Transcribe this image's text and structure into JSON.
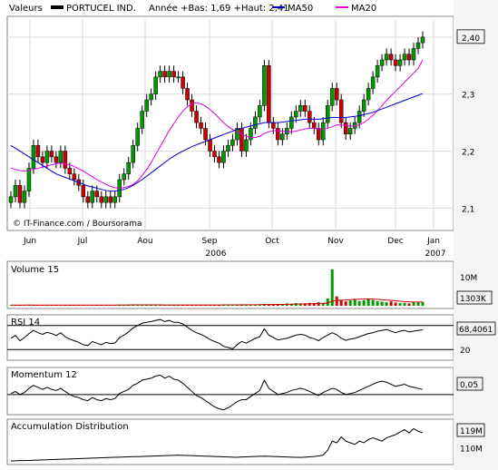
{
  "header": {
    "instrument_prefix": "Valeurs",
    "instrument": "PORTUCEL IND.",
    "range_text": "Année +Bas: 1,69 +Haut: 2,41",
    "ma50_label": "MA50",
    "ma20_label": "MA20"
  },
  "copyright": "© IT-Finance.com / Boursorama",
  "colors": {
    "up_candle": "#009900",
    "down_candle": "#cc0000",
    "ma50": "#0000cc",
    "ma20": "#dd00dd",
    "panel_bg": "#ffffff",
    "frame": "#888888"
  },
  "chart_data": [
    {
      "type": "candlestick",
      "panel": "price",
      "y_ticks": [
        "2,1",
        "2,2",
        "2,3",
        "2,40"
      ],
      "last_value": "2,40",
      "ylim": [
        2.08,
        2.43
      ],
      "x_ticks": [
        "Jun",
        "Jul",
        "Aou",
        "Sep",
        "Oct",
        "Nov",
        "Dec",
        "Jan"
      ],
      "x_subticks": [
        "2006",
        "2007"
      ],
      "closes": [
        2.12,
        2.14,
        2.11,
        2.13,
        2.17,
        2.21,
        2.19,
        2.18,
        2.2,
        2.19,
        2.18,
        2.2,
        2.17,
        2.16,
        2.15,
        2.14,
        2.12,
        2.11,
        2.13,
        2.12,
        2.11,
        2.12,
        2.11,
        2.12,
        2.15,
        2.16,
        2.18,
        2.21,
        2.24,
        2.27,
        2.29,
        2.3,
        2.33,
        2.34,
        2.33,
        2.34,
        2.33,
        2.33,
        2.31,
        2.29,
        2.27,
        2.25,
        2.24,
        2.22,
        2.2,
        2.19,
        2.18,
        2.2,
        2.21,
        2.22,
        2.24,
        2.2,
        2.22,
        2.24,
        2.26,
        2.28,
        2.35,
        2.25,
        2.24,
        2.22,
        2.23,
        2.24,
        2.26,
        2.27,
        2.28,
        2.27,
        2.25,
        2.24,
        2.22,
        2.25,
        2.28,
        2.31,
        2.29,
        2.25,
        2.23,
        2.24,
        2.25,
        2.27,
        2.29,
        2.31,
        2.33,
        2.35,
        2.36,
        2.37,
        2.36,
        2.35,
        2.36,
        2.37,
        2.36,
        2.38,
        2.39,
        2.4
      ],
      "ma50": [
        2.21,
        2.205,
        2.2,
        2.195,
        2.19,
        2.185,
        2.18,
        2.175,
        2.17,
        2.165,
        2.16,
        2.157,
        2.154,
        2.151,
        2.148,
        2.145,
        2.142,
        2.139,
        2.137,
        2.135,
        2.133,
        2.131,
        2.13,
        2.13,
        2.131,
        2.133,
        2.136,
        2.14,
        2.145,
        2.15,
        2.156,
        2.162,
        2.168,
        2.174,
        2.18,
        2.186,
        2.191,
        2.196,
        2.2,
        2.204,
        2.208,
        2.211,
        2.214,
        2.217,
        2.22,
        2.223,
        2.226,
        2.229,
        2.232,
        2.235,
        2.238,
        2.24,
        2.242,
        2.244,
        2.246,
        2.248,
        2.25,
        2.25,
        2.25,
        2.25,
        2.251,
        2.252,
        2.253,
        2.254,
        2.255,
        2.256,
        2.256,
        2.256,
        2.256,
        2.257,
        2.258,
        2.259,
        2.259,
        2.259,
        2.259,
        2.26,
        2.261,
        2.262,
        2.264,
        2.266,
        2.268,
        2.271,
        2.274,
        2.277,
        2.28,
        2.283,
        2.286,
        2.289,
        2.292,
        2.295,
        2.298,
        2.301
      ],
      "ma20": [
        2.17,
        2.168,
        2.166,
        2.165,
        2.166,
        2.168,
        2.17,
        2.172,
        2.174,
        2.176,
        2.178,
        2.179,
        2.178,
        2.176,
        2.173,
        2.169,
        2.165,
        2.16,
        2.155,
        2.15,
        2.146,
        2.142,
        2.138,
        2.136,
        2.135,
        2.136,
        2.138,
        2.142,
        2.148,
        2.157,
        2.168,
        2.18,
        2.194,
        2.208,
        2.222,
        2.236,
        2.248,
        2.26,
        2.27,
        2.278,
        2.283,
        2.285,
        2.283,
        2.279,
        2.273,
        2.266,
        2.258,
        2.25,
        2.243,
        2.238,
        2.234,
        2.23,
        2.226,
        2.224,
        2.224,
        2.226,
        2.231,
        2.234,
        2.236,
        2.236,
        2.235,
        2.234,
        2.234,
        2.235,
        2.237,
        2.239,
        2.24,
        2.24,
        2.238,
        2.238,
        2.24,
        2.243,
        2.246,
        2.246,
        2.245,
        2.244,
        2.244,
        2.246,
        2.25,
        2.256,
        2.263,
        2.271,
        2.28,
        2.289,
        2.297,
        2.305,
        2.313,
        2.321,
        2.329,
        2.337,
        2.345,
        2.36
      ]
    },
    {
      "type": "bar",
      "panel": "volume",
      "label": "Volume 15",
      "y_ticks": [
        "10M"
      ],
      "last_value": "1303K",
      "ylim": [
        0,
        14
      ],
      "values_millions": [
        0.2,
        0.3,
        0.2,
        0.1,
        0.4,
        0.3,
        0.2,
        0.2,
        0.3,
        0.2,
        0.2,
        0.1,
        0.3,
        0.2,
        0.2,
        0.3,
        0.2,
        0.1,
        0.2,
        0.3,
        0.2,
        0.2,
        0.1,
        0.2,
        0.3,
        0.3,
        0.4,
        0.5,
        0.4,
        0.3,
        0.3,
        0.4,
        0.3,
        0.2,
        0.2,
        0.3,
        0.2,
        0.3,
        0.2,
        0.3,
        0.3,
        0.2,
        0.3,
        0.3,
        0.2,
        0.3,
        0.3,
        0.4,
        0.3,
        0.2,
        0.3,
        0.5,
        0.4,
        0.3,
        0.4,
        0.4,
        0.6,
        0.5,
        0.4,
        0.5,
        0.6,
        0.8,
        0.7,
        0.9,
        0.6,
        0.8,
        1.0,
        0.9,
        1.2,
        0.8,
        2.5,
        12.5,
        3.2,
        2.0,
        1.5,
        1.8,
        2.2,
        1.6,
        1.9,
        2.4,
        2.0,
        1.6,
        1.4,
        1.2,
        1.5,
        1.1,
        0.9,
        1.0,
        0.8,
        1.2,
        1.1,
        1.3
      ],
      "average_millions": [
        0.25,
        0.25,
        0.25,
        0.25,
        0.25,
        0.25,
        0.25,
        0.25,
        0.25,
        0.25,
        0.25,
        0.25,
        0.25,
        0.25,
        0.25,
        0.25,
        0.25,
        0.25,
        0.25,
        0.25,
        0.25,
        0.25,
        0.25,
        0.25,
        0.26,
        0.27,
        0.28,
        0.3,
        0.3,
        0.3,
        0.3,
        0.3,
        0.3,
        0.3,
        0.29,
        0.28,
        0.28,
        0.28,
        0.28,
        0.28,
        0.28,
        0.28,
        0.28,
        0.28,
        0.28,
        0.28,
        0.29,
        0.3,
        0.3,
        0.3,
        0.3,
        0.32,
        0.34,
        0.35,
        0.36,
        0.37,
        0.4,
        0.42,
        0.43,
        0.45,
        0.48,
        0.52,
        0.55,
        0.6,
        0.62,
        0.65,
        0.7,
        0.74,
        0.8,
        0.82,
        0.95,
        1.6,
        1.8,
        1.9,
        2.0,
        2.1,
        2.2,
        2.25,
        2.3,
        2.35,
        2.3,
        2.2,
        2.1,
        1.95,
        1.85,
        1.7,
        1.55,
        1.45,
        1.35,
        1.3,
        1.3,
        1.3
      ]
    },
    {
      "type": "line",
      "panel": "rsi",
      "label": "RSI 14",
      "y_ticks": [
        "20"
      ],
      "last_value": "68,4061",
      "ylim": [
        0,
        100
      ],
      "levels": [
        80,
        20
      ],
      "values": [
        48,
        55,
        42,
        50,
        60,
        68,
        62,
        58,
        63,
        60,
        55,
        62,
        52,
        46,
        42,
        38,
        32,
        30,
        40,
        36,
        32,
        38,
        35,
        36,
        50,
        56,
        64,
        74,
        80,
        86,
        88,
        90,
        93,
        95,
        90,
        93,
        88,
        88,
        84,
        76,
        68,
        62,
        58,
        52,
        45,
        40,
        36,
        28,
        25,
        22,
        32,
        40,
        36,
        42,
        48,
        52,
        72,
        56,
        50,
        44,
        46,
        48,
        52,
        56,
        58,
        56,
        50,
        47,
        42,
        50,
        56,
        62,
        57,
        48,
        43,
        46,
        48,
        52,
        56,
        60,
        62,
        66,
        68,
        70,
        66,
        62,
        66,
        68,
        64,
        66,
        68,
        69
      ]
    },
    {
      "type": "line",
      "panel": "momentum",
      "label": "Momentum 12",
      "y_ticks": [],
      "last_value": "0,05",
      "ylim": [
        -0.17,
        0.22
      ],
      "zero_line": 0,
      "values": [
        0.01,
        0.03,
        0.0,
        0.02,
        0.06,
        0.09,
        0.07,
        0.05,
        0.07,
        0.05,
        0.04,
        0.06,
        0.03,
        0.0,
        -0.02,
        -0.03,
        -0.05,
        -0.06,
        -0.03,
        -0.05,
        -0.06,
        -0.04,
        -0.05,
        -0.04,
        0.01,
        0.03,
        0.05,
        0.09,
        0.11,
        0.14,
        0.15,
        0.16,
        0.18,
        0.19,
        0.16,
        0.18,
        0.15,
        0.14,
        0.11,
        0.07,
        0.03,
        -0.01,
        -0.03,
        -0.06,
        -0.09,
        -0.12,
        -0.14,
        -0.15,
        -0.13,
        -0.1,
        -0.07,
        -0.05,
        -0.05,
        -0.02,
        0.01,
        0.04,
        0.14,
        0.06,
        0.03,
        0.0,
        0.01,
        0.02,
        0.04,
        0.05,
        0.06,
        0.05,
        0.03,
        0.01,
        -0.01,
        0.02,
        0.04,
        0.06,
        0.05,
        0.02,
        0.0,
        0.01,
        0.02,
        0.04,
        0.06,
        0.08,
        0.1,
        0.12,
        0.13,
        0.12,
        0.1,
        0.08,
        0.09,
        0.1,
        0.08,
        0.07,
        0.06,
        0.05
      ]
    },
    {
      "type": "line",
      "panel": "accumulation",
      "label": "Accumulation Distribution",
      "y_ticks": [
        "110M"
      ],
      "last_value": "119M",
      "ylim": [
        102,
        124
      ],
      "values_millions": [
        102.0,
        102.1,
        102.2,
        102.2,
        102.3,
        102.4,
        102.5,
        102.6,
        102.7,
        102.8,
        102.9,
        103.0,
        103.1,
        103.2,
        103.3,
        103.4,
        103.5,
        103.6,
        103.7,
        103.8,
        103.9,
        104.0,
        104.1,
        104.2,
        104.3,
        104.4,
        104.5,
        104.6,
        104.6,
        104.7,
        104.8,
        104.9,
        105.0,
        105.1,
        105.2,
        105.3,
        105.4,
        105.5,
        105.4,
        105.3,
        105.2,
        105.1,
        105.0,
        104.9,
        104.8,
        104.7,
        104.6,
        104.5,
        104.4,
        104.3,
        104.2,
        104.4,
        104.5,
        104.6,
        104.7,
        104.8,
        104.9,
        104.8,
        104.7,
        104.6,
        104.5,
        104.4,
        104.3,
        104.2,
        104.1,
        104.3,
        104.5,
        104.7,
        105.0,
        105.5,
        108.5,
        114.0,
        113.0,
        116.5,
        114.0,
        113.0,
        112.0,
        114.0,
        113.0,
        115.0,
        116.0,
        115.0,
        114.0,
        116.0,
        117.0,
        118.0,
        119.5,
        121.0,
        119.0,
        121.5,
        120.0,
        119.0
      ]
    }
  ]
}
